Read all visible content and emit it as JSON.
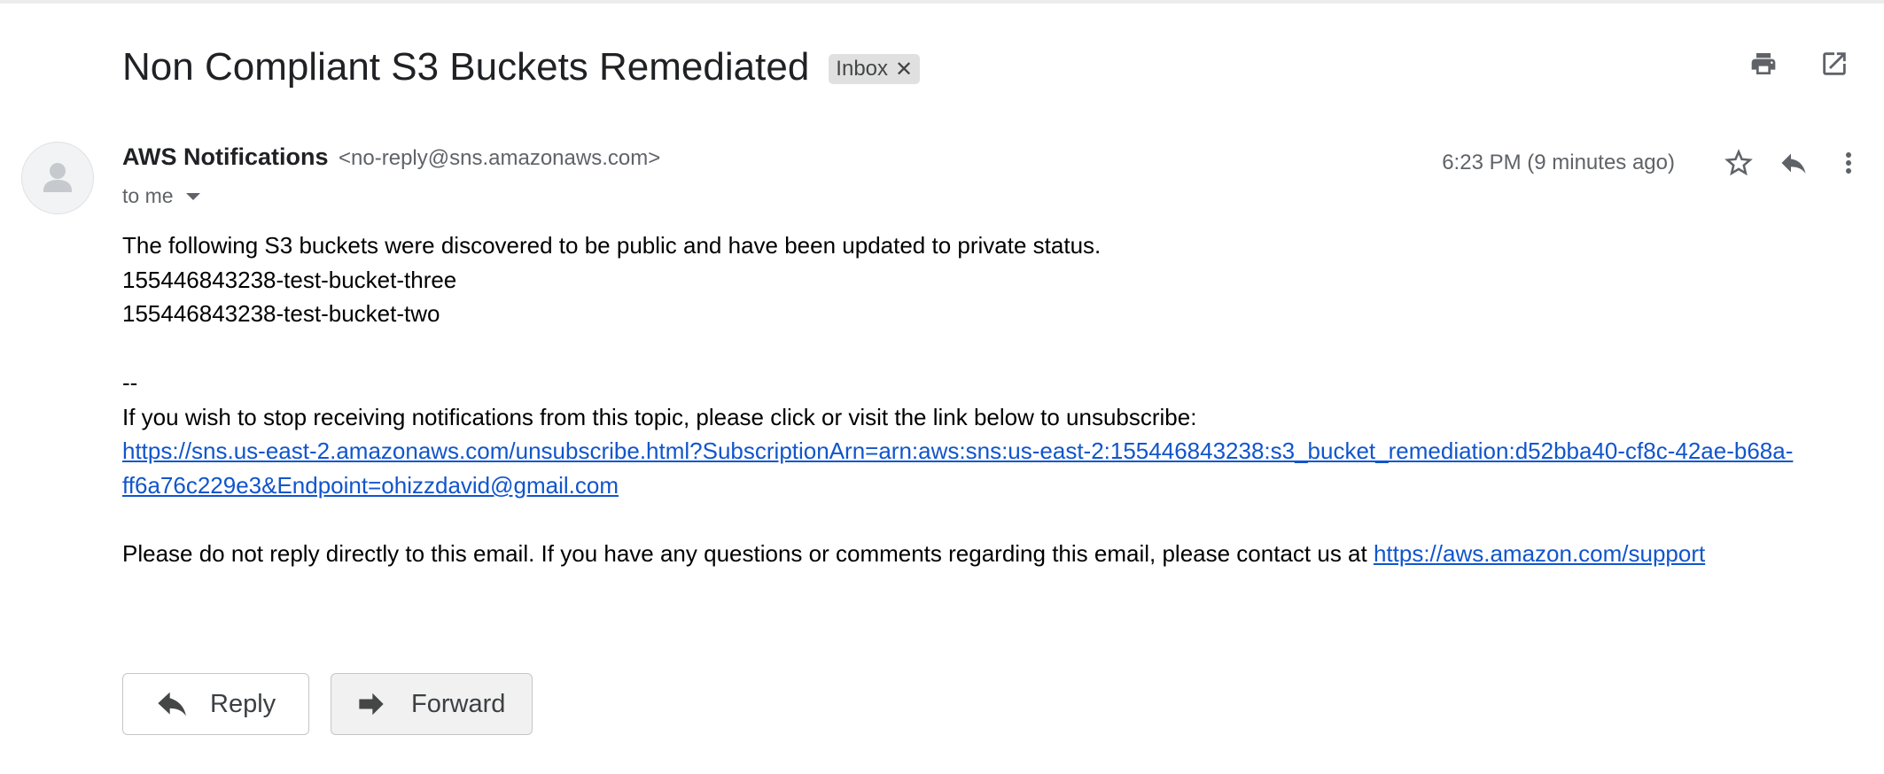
{
  "email": {
    "subject": "Non Compliant S3 Buckets Remediated",
    "label": "Inbox",
    "sender_name": "AWS Notifications",
    "sender_email": "<no-reply@sns.amazonaws.com>",
    "recipient": "to me",
    "timestamp": "6:23 PM (9 minutes ago)",
    "body": {
      "intro": "The following S3 buckets were discovered to be public and have been updated to private status.",
      "buckets": [
        "155446843238-test-bucket-three",
        "155446843238-test-bucket-two"
      ],
      "signature_separator": "--",
      "unsubscribe_text": "If you wish to stop receiving notifications from this topic, please click or visit the link below to unsubscribe:",
      "unsubscribe_link_line1": "https://sns.us-east-2.amazonaws.com/unsubscribe.html?SubscriptionArn=arn:aws:sns:us-east-2:155446843238:s3_bucket_remediation:d52bba40-cf8c-42ae-b68a-",
      "unsubscribe_link_line2": "ff6a76c229e3&Endpoint=ohizzdavid@gmail.com",
      "support_text": "Please do not reply directly to this email. If you have any questions or comments regarding this email, please contact us at ",
      "support_link": "https://aws.amazon.com/support"
    }
  },
  "actions": {
    "reply_label": "Reply",
    "forward_label": "Forward"
  },
  "icons": {
    "print": "print-icon",
    "open_new_window": "open-in-new-window-icon",
    "star": "star-icon",
    "reply": "reply-icon",
    "more": "more-vert-icon",
    "forward": "forward-icon",
    "avatar": "person-icon"
  },
  "colors": {
    "link": "#1155cc",
    "chip_bg": "#e0e0e0",
    "icon": "#5f6368"
  }
}
